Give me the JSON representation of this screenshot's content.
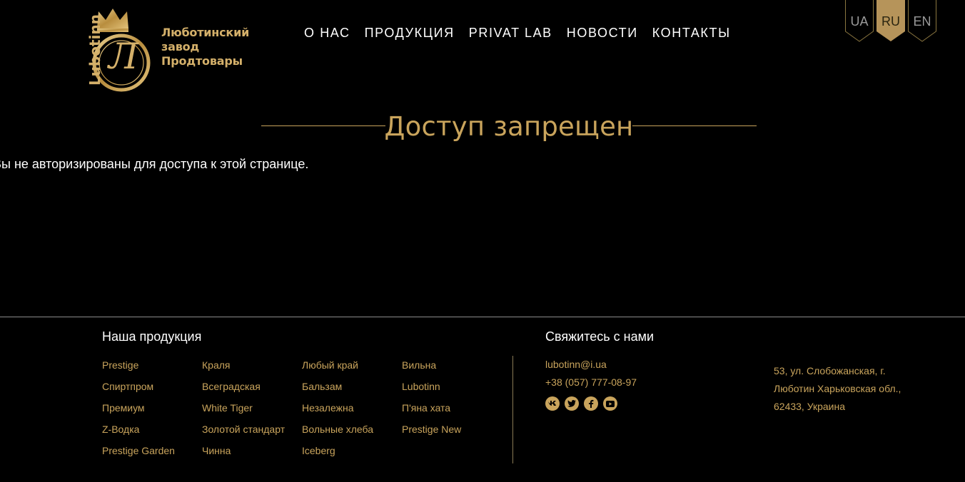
{
  "brand": {
    "logo_vertical": "Lubotinn",
    "logo_monogram": "Л",
    "name_lines": [
      "Люботинский",
      "завод",
      "Продтовары"
    ]
  },
  "nav": {
    "items": [
      "О НАС",
      "ПРОДУКЦИЯ",
      "PRIVAT LAB",
      "НОВОСТИ",
      "КОНТАКТЫ"
    ]
  },
  "languages": {
    "items": [
      "UA",
      "RU",
      "EN"
    ],
    "active": "RU"
  },
  "page": {
    "title": "Доступ запрещен",
    "message": "Вы не авторизированы для доступа к этой странице."
  },
  "footer": {
    "products_heading": "Наша продукция",
    "products_columns": [
      [
        "Prestige",
        "Спиртпром",
        "Премиум",
        "Z-Водка",
        "Prestige Garden"
      ],
      [
        "Краля",
        "Всеградская",
        "White Tiger",
        "Золотой стандарт",
        "Чинна"
      ],
      [
        "Любый край",
        "Бальзам",
        "Незалежна",
        "Вольные хлеба",
        "Iceberg"
      ],
      [
        "Вильна",
        "Lubotinn",
        "П'яна хата",
        "Prestige New"
      ]
    ],
    "contact_heading": "Свяжитесь с нами",
    "email": "lubotinn@i.ua",
    "phone": "+38 (057) 777-08-97",
    "socials": [
      "vk-icon",
      "twitter-icon",
      "facebook-icon",
      "youtube-icon"
    ],
    "address_lines": [
      "53, ул. Слобожанская, г.",
      "Люботин Харьковская обл.,",
      "62433, Украина"
    ]
  },
  "colors": {
    "background": "#000000",
    "gold": "#c9a45c",
    "text": "#ffffff"
  }
}
